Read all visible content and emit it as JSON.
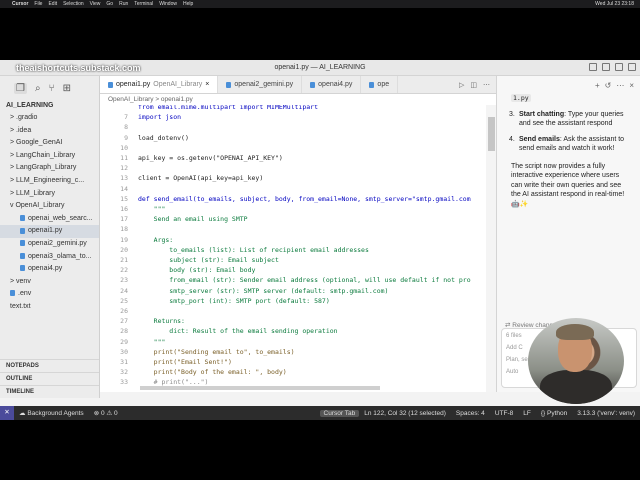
{
  "menubar": {
    "items": [
      "Cursor",
      "File",
      "Edit",
      "Selection",
      "View",
      "Go",
      "Run",
      "Terminal",
      "Window",
      "Help"
    ],
    "clock": "Wed Jul 23 23:18"
  },
  "window": {
    "watermark": "theaishortcuts.substack.com",
    "title": "openai1.py — AI_LEARNING"
  },
  "sidebar": {
    "project": "AI_LEARNING",
    "items": [
      {
        "label": "> .gradio",
        "indent": 1
      },
      {
        "label": "> .idea",
        "indent": 1
      },
      {
        "label": "> Google_GenAI",
        "indent": 1
      },
      {
        "label": "> LangChain_Library",
        "indent": 1
      },
      {
        "label": "> LangGraph_Library",
        "indent": 1
      },
      {
        "label": "> LLM_Engineering_c...",
        "indent": 1
      },
      {
        "label": "> LLM_Library",
        "indent": 1
      },
      {
        "label": "v OpenAI_Library",
        "indent": 1
      },
      {
        "label": "openai_web_searc...",
        "indent": 2,
        "file": true
      },
      {
        "label": "openai1.py",
        "indent": 2,
        "file": true,
        "selected": true
      },
      {
        "label": "openai2_gemini.py",
        "indent": 2,
        "file": true
      },
      {
        "label": "openai3_olama_to...",
        "indent": 2,
        "file": true
      },
      {
        "label": "openai4.py",
        "indent": 2,
        "file": true
      },
      {
        "label": "> venv",
        "indent": 1
      },
      {
        "label": ".env",
        "indent": 1,
        "file": true
      },
      {
        "label": "text.txt",
        "indent": 1
      }
    ],
    "bottom": [
      "NOTEPADS",
      "OUTLINE",
      "TIMELINE"
    ]
  },
  "tabs": [
    {
      "label": "openai1.py",
      "sub": "OpenAI_Library",
      "active": true
    },
    {
      "label": "openai2_gemini.py",
      "active": false
    },
    {
      "label": "openai4.py",
      "active": false
    },
    {
      "label": "ope",
      "active": false
    }
  ],
  "breadcrumb": "OpenAI_Library  >  openai1.py",
  "code_lines": [
    {
      "n": "",
      "t": "from email.mime.multipart import MIMEMultipart"
    },
    {
      "n": "7",
      "t": "import json"
    },
    {
      "n": "8",
      "t": ""
    },
    {
      "n": "9",
      "t": "load_dotenv()"
    },
    {
      "n": "10",
      "t": ""
    },
    {
      "n": "11",
      "t": "api_key = os.getenv(\"OPENAI_API_KEY\")"
    },
    {
      "n": "12",
      "t": ""
    },
    {
      "n": "13",
      "t": "client = OpenAI(api_key=api_key)"
    },
    {
      "n": "14",
      "t": ""
    },
    {
      "n": "15",
      "t": "def send_email(to_emails, subject, body, from_email=None, smtp_server=\"smtp.gmail.com"
    },
    {
      "n": "16",
      "t": "    \"\"\""
    },
    {
      "n": "17",
      "t": "    Send an email using SMTP"
    },
    {
      "n": "18",
      "t": ""
    },
    {
      "n": "19",
      "t": "    Args:"
    },
    {
      "n": "20",
      "t": "        to_emails (list): List of recipient email addresses"
    },
    {
      "n": "21",
      "t": "        subject (str): Email subject"
    },
    {
      "n": "22",
      "t": "        body (str): Email body"
    },
    {
      "n": "23",
      "t": "        from_email (str): Sender email address (optional, will use default if not pro"
    },
    {
      "n": "24",
      "t": "        smtp_server (str): SMTP server (default: smtp.gmail.com)"
    },
    {
      "n": "25",
      "t": "        smtp_port (int): SMTP port (default: 587)"
    },
    {
      "n": "26",
      "t": ""
    },
    {
      "n": "27",
      "t": "    Returns:"
    },
    {
      "n": "28",
      "t": "        dict: Result of the email sending operation"
    },
    {
      "n": "29",
      "t": "    \"\"\""
    },
    {
      "n": "30",
      "t": "    print(\"Sending email to\", to_emails)"
    },
    {
      "n": "31",
      "t": "    print(\"Email Sent!\")"
    },
    {
      "n": "32",
      "t": "    print(\"Body of the email: \", body)"
    },
    {
      "n": "33",
      "t": "    # print(\"...\")"
    }
  ],
  "chat": {
    "chip": "1.py",
    "step3_title": "Start chatting",
    "step3_text": ": Type your queries and see the assistant respond",
    "step4_title": "Send emails",
    "step4_text": ": Ask the assistant to send emails and watch it work!",
    "summary": "The script now provides a fully interactive experience where users can write their own queries and see the AI assistant respond in real-time! 🤖✨",
    "review": "Review changes",
    "input_hint1": "6 files",
    "input_hint2": "Add C",
    "input_placeholder": "Plan, search, b",
    "mode": "Auto"
  },
  "statusbar": {
    "agents": "Background Agents",
    "errors": "0",
    "warnings": "0",
    "cursor_tab": "Cursor Tab",
    "position": "Ln 122, Col 32 (12 selected)",
    "spaces": "Spaces: 4",
    "encoding": "UTF-8",
    "eol": "LF",
    "language": "Python",
    "interpreter": "3.13.3 ('venv': venv)"
  },
  "colors": {
    "accent": "#4b4b9b",
    "keyword": "#0000c0",
    "string": "#a31515",
    "docstring": "#0a7a3c"
  }
}
